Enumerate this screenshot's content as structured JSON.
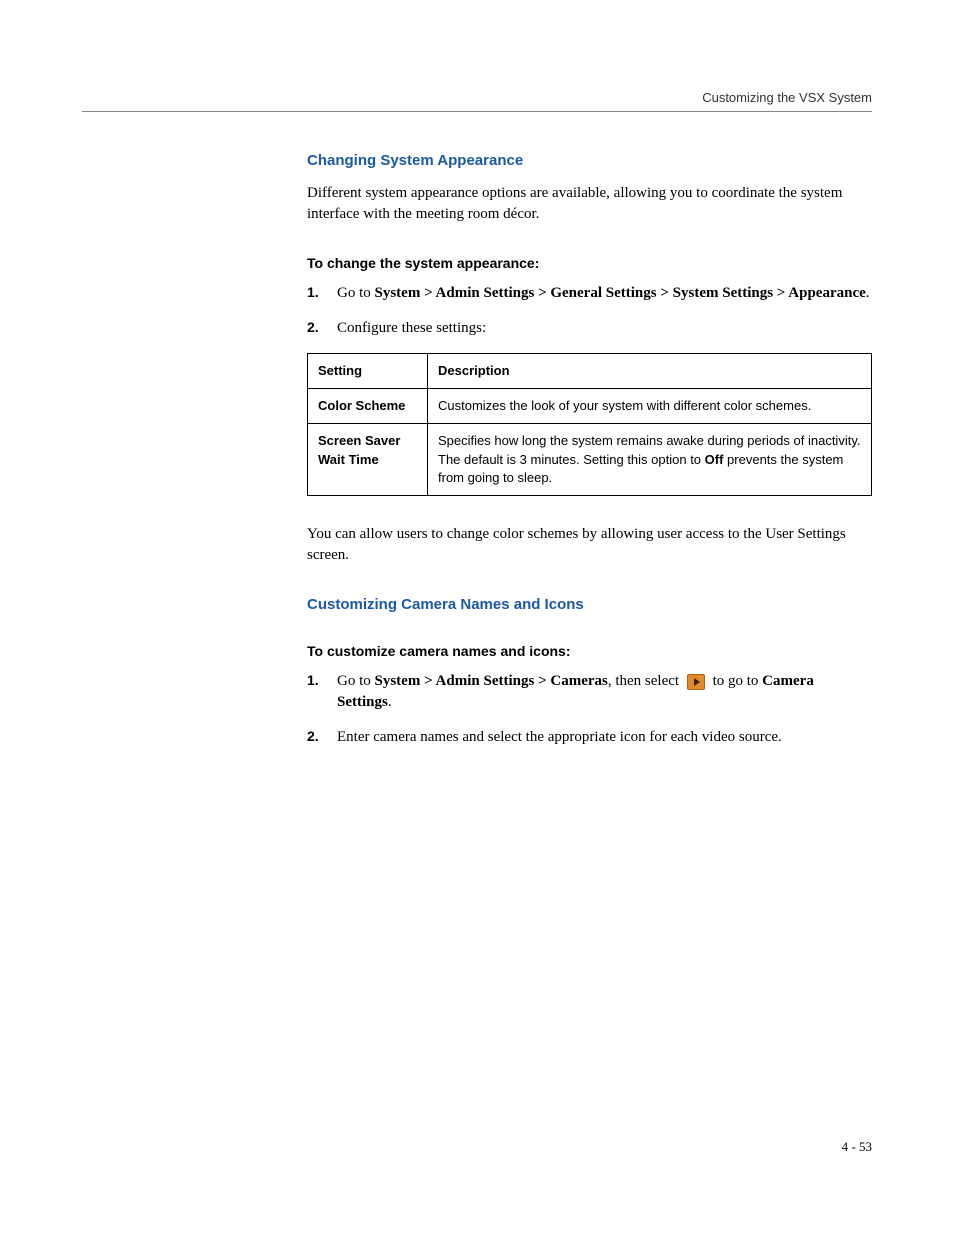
{
  "header": {
    "right": "Customizing the VSX System"
  },
  "section1": {
    "heading": "Changing System Appearance",
    "intro": "Different system appearance options are available, allowing you to coordinate the system interface with the meeting room décor.",
    "subheading": "To change the system appearance:",
    "step1_prefix": "Go to ",
    "step1_bold": "System > Admin Settings > General Settings > System Settings > Appearance",
    "step1_suffix": ".",
    "step2": "Configure these settings:",
    "table": {
      "col1": "Setting",
      "col2": "Description",
      "row1": {
        "setting": "Color Scheme",
        "desc": "Customizes the look of your system with different color schemes."
      },
      "row2": {
        "setting": "Screen Saver Wait Time",
        "desc_a": "Specifies how long the system remains awake during periods of inactivity. The default is 3 minutes. Setting this option to ",
        "desc_bold": "Off",
        "desc_b": " prevents the system from going to sleep."
      }
    },
    "outro": "You can allow users to change color schemes by allowing user access to the User Settings screen."
  },
  "section2": {
    "heading": "Customizing Camera Names and Icons",
    "subheading": "To customize camera names and icons:",
    "step1_prefix": "Go to ",
    "step1_bold1": "System > Admin Settings > Cameras",
    "step1_mid": ", then select ",
    "step1_after_icon": " to go to ",
    "step1_bold2": "Camera Settings",
    "step1_suffix": ".",
    "step2": "Enter camera names and select the appropriate icon for each video source."
  },
  "footer": {
    "pagenum": "4 - 53"
  }
}
